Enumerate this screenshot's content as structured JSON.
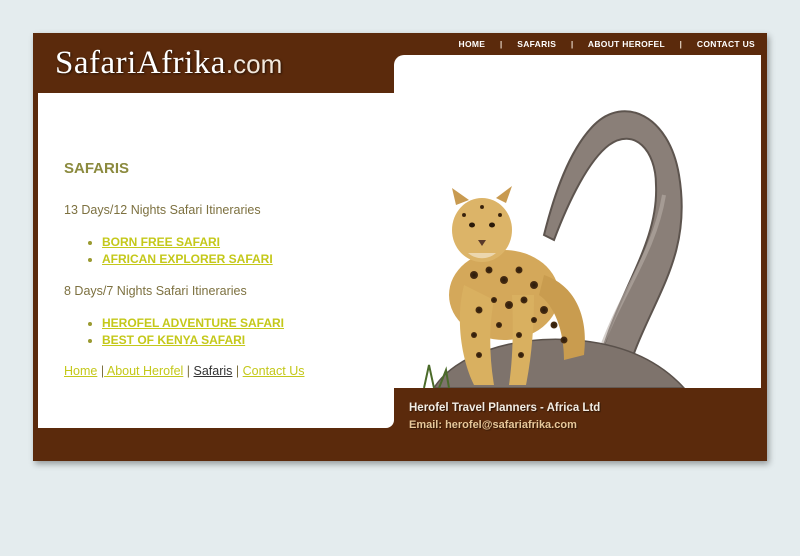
{
  "logo": {
    "brand": "SafariAfrika",
    "tld": ".com"
  },
  "topnav": {
    "home": "HOME",
    "safaris": "SAFARIS",
    "about": "ABOUT HEROFEL",
    "contact": "CONTACT US",
    "separator": "|"
  },
  "main": {
    "heading": "SAFARIS",
    "group1": {
      "title": "13 Days/12 Nights Safari Itineraries",
      "links": [
        "BORN FREE SAFARI",
        "AFRICAN EXPLORER SAFARI"
      ]
    },
    "group2": {
      "title": "8 Days/7 Nights Safari Itineraries",
      "links": [
        "HEROFEL ADVENTURE SAFARI",
        "BEST OF KENYA SAFARI"
      ]
    }
  },
  "footer_nav": {
    "home": "Home",
    "about": " About Herofel",
    "safaris": "Safaris",
    "contact": "Contact Us",
    "separator": "|"
  },
  "footer": {
    "company": "Herofel Travel Planners - Africa Ltd",
    "email": "Email: herofel@safariafrika.com"
  },
  "colors": {
    "brown": "#5b2a0c",
    "heading": "#8b8a3e",
    "link": "#c4c81a",
    "background": "#e4ecee"
  }
}
